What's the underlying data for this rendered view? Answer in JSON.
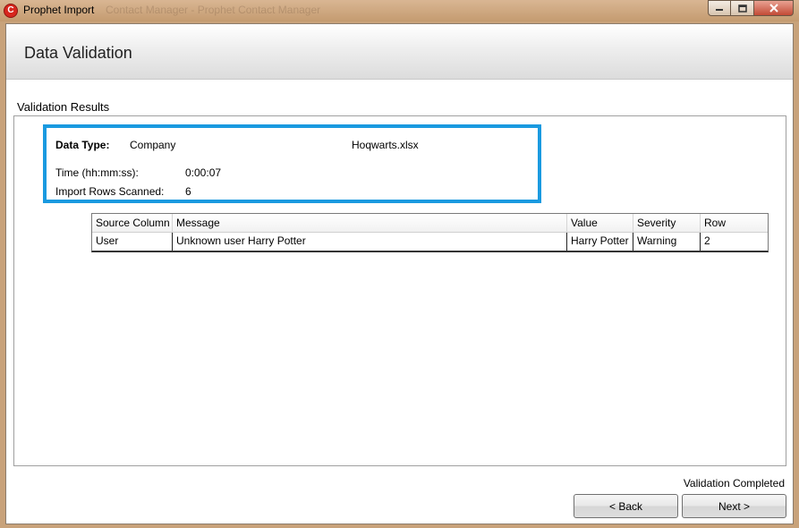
{
  "window": {
    "title": "Prophet Import",
    "ghost_title": "Contact Manager - Prophet Contact Manager",
    "icon": "prophet-logo-icon",
    "controls": [
      "minimize-icon",
      "maximize-icon",
      "close-icon"
    ]
  },
  "header": {
    "title": "Data Validation"
  },
  "section": {
    "label": "Validation Results"
  },
  "summary": {
    "data_type_label": "Data Type:",
    "data_type_value": "Company",
    "file_name": "Hoqwarts.xlsx",
    "time_label": "Time (hh:mm:ss):",
    "time_value": "0:00:07",
    "rows_label": "Import Rows Scanned:",
    "rows_value": "6"
  },
  "grid": {
    "columns": [
      "Source Column",
      "Message",
      "Value",
      "Severity",
      "Row"
    ],
    "rows": [
      [
        "User",
        "Unknown user Harry Potter",
        "Harry Potter",
        "Warning",
        "2"
      ]
    ]
  },
  "footer": {
    "status": "Validation Completed",
    "back_label": "< Back",
    "next_label": "Next >"
  },
  "colors": {
    "highlight_border": "#1a9ae0"
  }
}
